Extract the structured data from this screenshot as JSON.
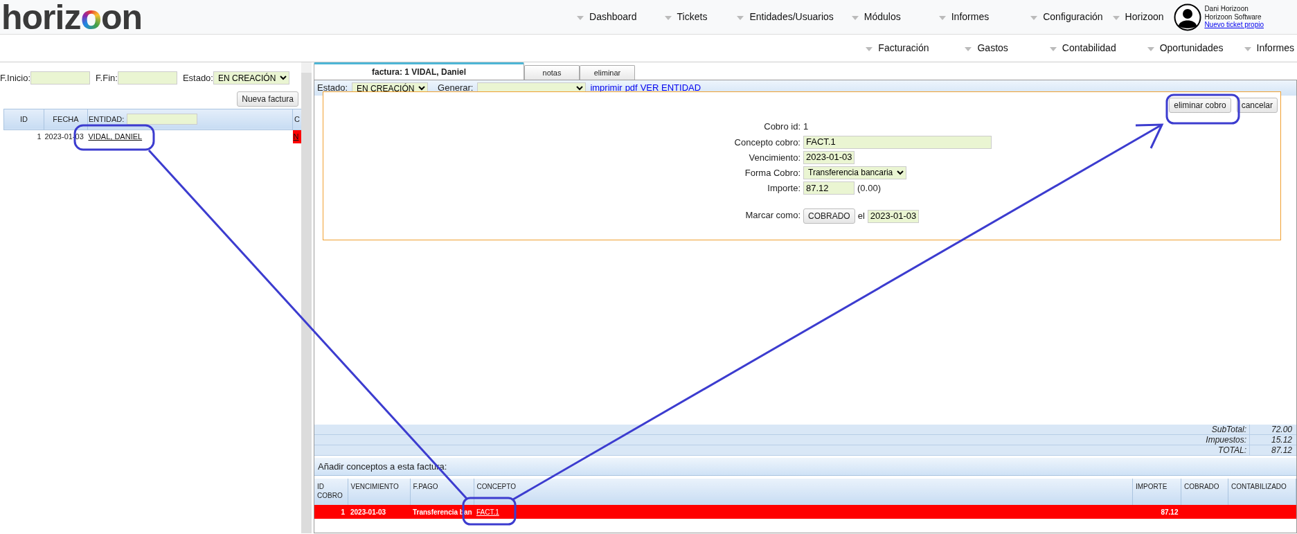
{
  "logo": "horizoon",
  "nav_primary": [
    {
      "label": "Dashboard"
    },
    {
      "label": "Tickets"
    },
    {
      "label": "Entidades/Usuarios"
    },
    {
      "label": "Módulos"
    },
    {
      "label": "Informes"
    },
    {
      "label": "Configuración"
    },
    {
      "label": "Horizoon"
    }
  ],
  "user": {
    "name": "Dani Horizoon",
    "company": "Horizoon Software",
    "link": "Nuevo ticket propio"
  },
  "nav_secondary": [
    {
      "label": "Facturación"
    },
    {
      "label": "Gastos"
    },
    {
      "label": "Contabilidad"
    },
    {
      "label": "Oportunidades"
    },
    {
      "label": "Informes"
    }
  ],
  "filters": {
    "start_label": "F.Inicio:",
    "end_label": "F.Fin:",
    "status_label": "Estado:",
    "status": "EN CREACIÓN"
  },
  "new_invoice_button": "Nueva factura",
  "invoice_list": {
    "columns": [
      "ID",
      "FECHA",
      "ENTIDAD:",
      "C"
    ],
    "rows": [
      {
        "id": "1",
        "date": "2023-01-03",
        "entity": "VIDAL, DANIEL",
        "column_4": "N"
      }
    ]
  },
  "tabs": [
    {
      "label": "factura: 1 VIDAL, Daniel",
      "selected": true
    },
    {
      "label": "notas",
      "selected": false
    },
    {
      "label": "eliminar",
      "selected": false
    }
  ],
  "toolbar": {
    "status_label": "Estado:",
    "status": "EN CREACIÓN",
    "generate_label": "Generar:",
    "links": [
      "imprimir",
      "pdf",
      "VER ENTIDAD"
    ]
  },
  "payment_dialog": {
    "buttons": [
      "eliminar cobro",
      "cancelar"
    ],
    "fields": [
      {
        "kind": "text",
        "label": "Cobro id:",
        "value": "1"
      },
      {
        "kind": "input",
        "label": "Concepto cobro:",
        "value": "FACT.1"
      },
      {
        "kind": "input",
        "label": "Vencimiento:",
        "value": "2023-01-03"
      },
      {
        "kind": "select",
        "label": "Forma Cobro:",
        "value": "Transferencia bancaria"
      },
      {
        "kind": "input",
        "label": "Importe:",
        "value": "87.12",
        "note": "(0.00)"
      },
      {
        "kind": "mark",
        "label": "Marcar como:",
        "button": "COBRADO",
        "connector": "el",
        "value": "2023-01-03"
      }
    ]
  },
  "totals": [
    {
      "label": "SubTotal:",
      "value": "72.00"
    },
    {
      "label": "Impuestos:",
      "value": "15.12"
    },
    {
      "label": "TOTAL:",
      "value": "87.12"
    }
  ],
  "add_concepts_label": "Añadir conceptos a esta factura:",
  "payments": {
    "columns": [
      "ID COBRO",
      "VENCIMIENTO",
      "F.PAGO",
      "CONCEPTO",
      "IMPORTE",
      "COBRADO",
      "CONTABILIZADO"
    ],
    "rows": [
      {
        "id": "1",
        "due": "2023-01-03",
        "method": "Transferencia ban",
        "concept": "FACT.1",
        "amount": "87.12"
      }
    ]
  }
}
